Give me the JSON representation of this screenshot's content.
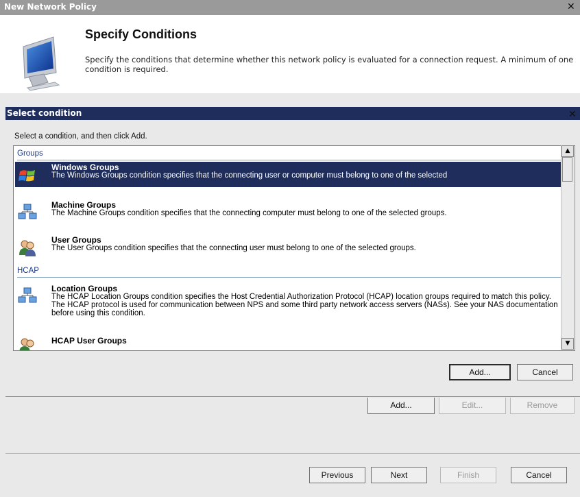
{
  "outer": {
    "title": "New Network Policy",
    "close_glyph": "✕",
    "header": {
      "title": "Specify Conditions",
      "description": "Specify the conditions that determine whether this network policy is evaluated for a connection request. A minimum of one condition is required."
    },
    "buttons": {
      "add": "Add...",
      "edit": "Edit...",
      "remove": "Remove"
    },
    "footer": {
      "previous": "Previous",
      "next": "Next",
      "finish": "Finish",
      "cancel": "Cancel"
    }
  },
  "dialog": {
    "title": "Select condition",
    "close_glyph": "✕",
    "instruction": "Select a condition, and then click Add.",
    "groups": [
      {
        "label": "Groups"
      },
      {
        "label": "HCAP"
      }
    ],
    "items": [
      {
        "name": "Windows Groups",
        "description": "The Windows Groups condition specifies that the connecting user or computer must belong to one of the selected",
        "icon": "windows-groups-icon",
        "selected": true
      },
      {
        "name": "Machine Groups",
        "description": "The Machine Groups condition specifies that the connecting computer must belong to one of the selected groups.",
        "icon": "machine-groups-icon",
        "selected": false
      },
      {
        "name": "User Groups",
        "description": "The User Groups condition specifies that the connecting user must belong to one of the selected groups.",
        "icon": "user-groups-icon",
        "selected": false
      },
      {
        "name": "Location Groups",
        "description": "The HCAP Location Groups condition specifies the Host Credential Authorization Protocol (HCAP) location groups required to match this policy. The HCAP protocol is used for communication between NPS and some third party network access servers (NASs). See your NAS documentation before using this condition.",
        "icon": "location-groups-icon",
        "selected": false
      },
      {
        "name": "HCAP User Groups",
        "description": "",
        "icon": "hcap-user-groups-icon",
        "selected": false
      }
    ],
    "buttons": {
      "add": "Add...",
      "cancel": "Cancel"
    },
    "scrollbar": {
      "up_glyph": "▲",
      "down_glyph": "▼"
    }
  },
  "colors": {
    "selection": "#1e2d5c",
    "title_bar": "#9a9a9a",
    "group_text": "#1a3a8a"
  }
}
